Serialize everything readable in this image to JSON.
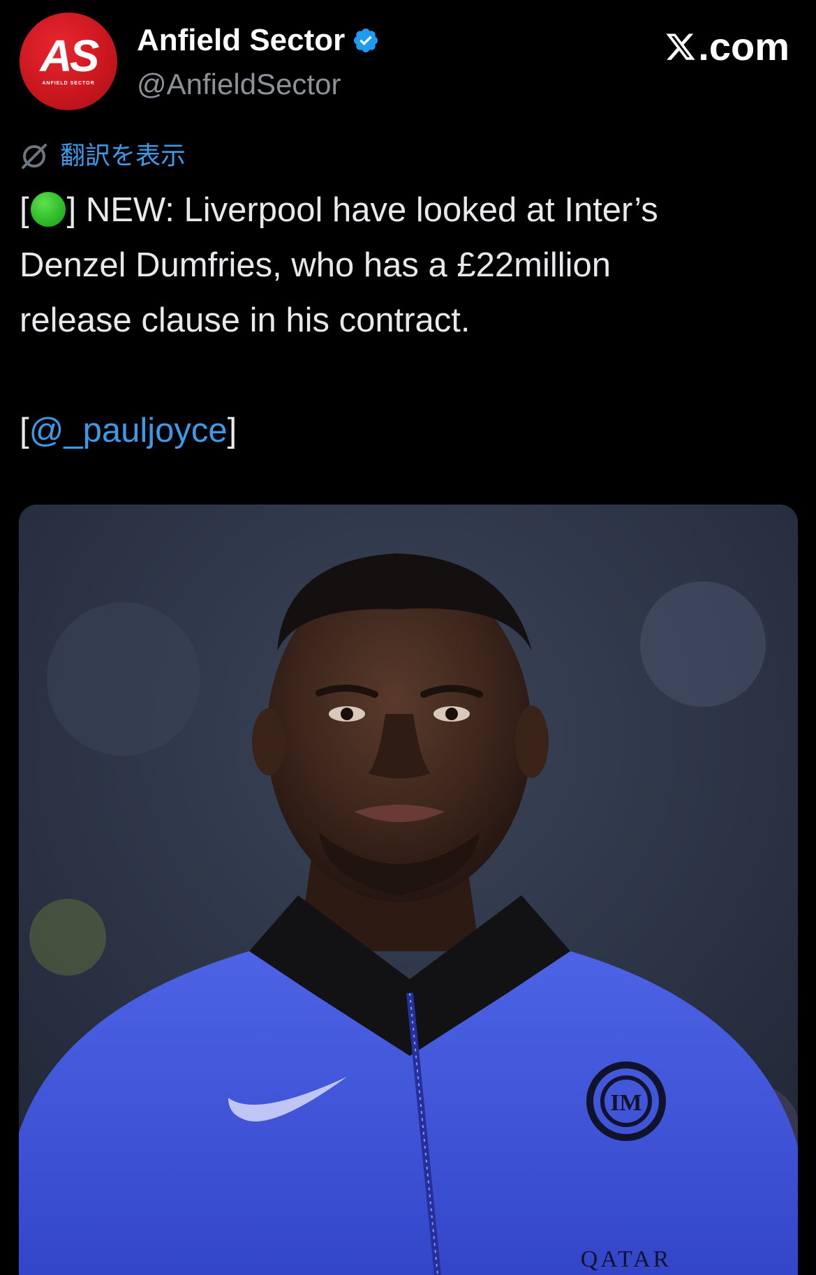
{
  "account": {
    "display_name": "Anfield Sector",
    "handle": "@AnfieldSector",
    "avatar_letters": "AS",
    "avatar_subtext": "ANFIELD SECTOR",
    "verified": true,
    "verified_color": "#1d9bf0"
  },
  "brand": {
    "label": ".com",
    "icon": "x-logo-icon"
  },
  "translate": {
    "label": "翻訳を表示",
    "icon": "translate-icon",
    "color": "#3b9be9"
  },
  "tweet": {
    "open_bracket": "[",
    "status_icon": "green-circle-emoji",
    "line1_rest": "] NEW: Liverpool have looked at Inter’s",
    "line2": "Denzel Dumfries, who has a £22million",
    "line3": "release clause in his contract.",
    "credit_open": "[",
    "credit_mention": "@_pauljoyce",
    "credit_close": "]",
    "mention_color": "#3b9be9"
  },
  "media": {
    "type": "photo",
    "jacket_color": "#3f55d8",
    "crest_text": "IM",
    "sponsor_text": "QATAR"
  },
  "colors": {
    "background": "#000000",
    "text": "#e7e9ea",
    "muted": "#8b9299",
    "avatar_red": "#d11a22"
  }
}
